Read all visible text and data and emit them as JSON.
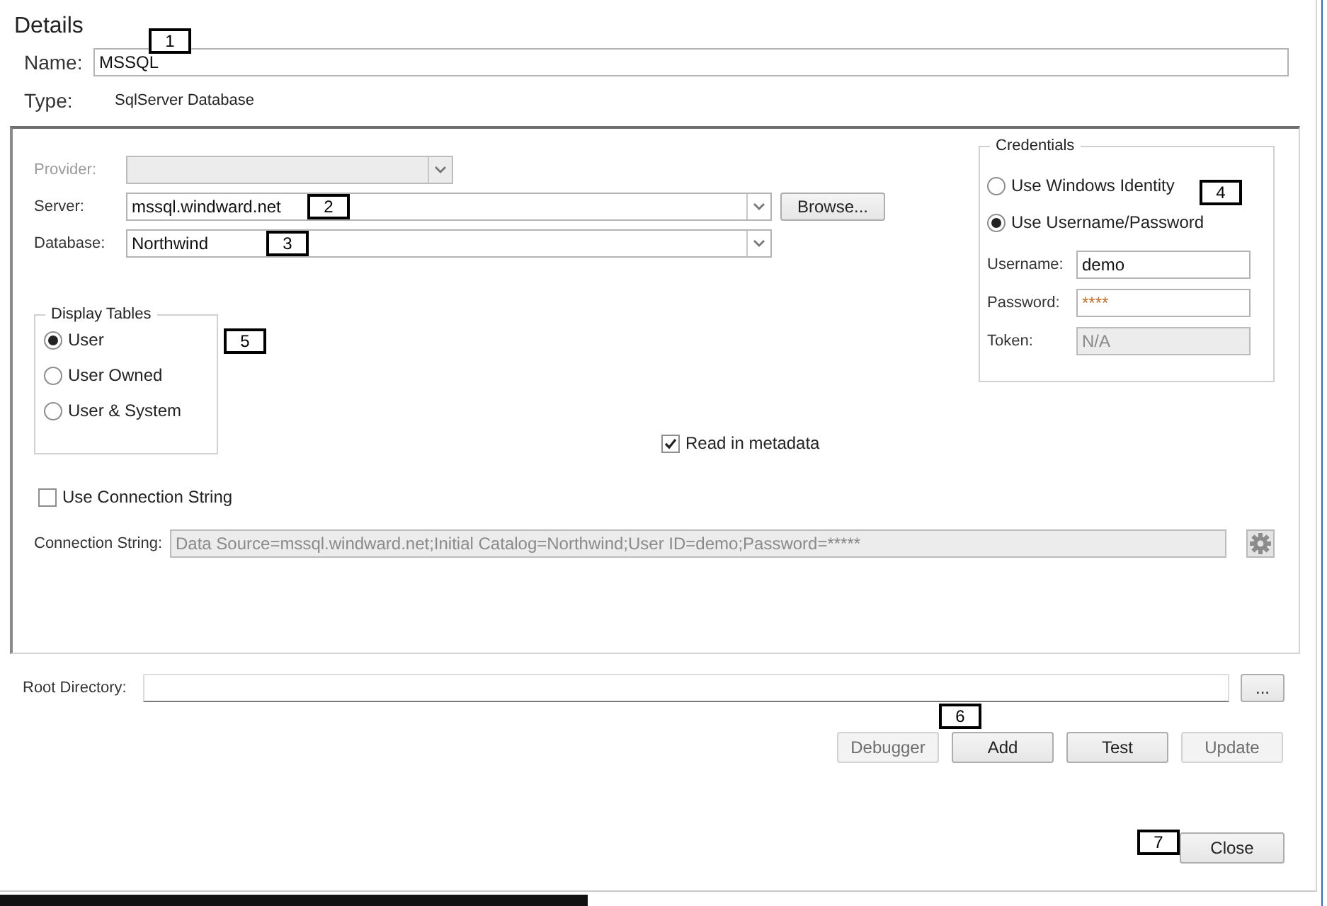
{
  "title": "Details",
  "name_field": {
    "label": "Name:",
    "value": "MSSQL"
  },
  "type": {
    "label": "Type:",
    "value": "SqlServer Database"
  },
  "provider": {
    "label": "Provider:",
    "disabled": true
  },
  "server": {
    "label": "Server:",
    "value": "mssql.windward.net",
    "disabled": false
  },
  "browse_button": {
    "label": "Browse...",
    "disabled": false
  },
  "database": {
    "label": "Database:",
    "value": "Northwind",
    "disabled": false
  },
  "display_tables": {
    "title": "Display Tables",
    "options": [
      {
        "label": "User",
        "selected": true
      },
      {
        "label": "User Owned",
        "selected": false
      },
      {
        "label": "User & System",
        "selected": false
      }
    ]
  },
  "read_metadata": {
    "label": "Read in metadata",
    "checked": true
  },
  "use_connection_string": {
    "label": "Use Connection String",
    "checked": false
  },
  "connection_string": {
    "label": "Connection String:",
    "value": "Data Source=mssql.windward.net;Initial Catalog=Northwind;User ID=demo;Password=*****",
    "disabled": true
  },
  "credentials": {
    "title": "Credentials",
    "options": [
      {
        "label": "Use Windows Identity",
        "selected": false
      },
      {
        "label": "Use Username/Password",
        "selected": true
      }
    ],
    "fields": [
      {
        "kind": "text",
        "label": "Username:",
        "value": "demo",
        "disabled": false
      },
      {
        "kind": "password",
        "label": "Password:",
        "value": "****",
        "disabled": false
      },
      {
        "kind": "text",
        "label": "Token:",
        "value": "N/A",
        "disabled": true
      }
    ]
  },
  "root_directory": {
    "label": "Root Directory:"
  },
  "root_browse_button": {
    "label": "...",
    "disabled": false
  },
  "actions": [
    {
      "label": "Debugger",
      "disabled": true
    },
    {
      "label": "Add",
      "disabled": false
    },
    {
      "label": "Test",
      "disabled": false
    },
    {
      "label": "Update",
      "disabled": true
    }
  ],
  "close_button": {
    "label": "Close",
    "disabled": false
  },
  "callouts": [
    {
      "number": "1"
    },
    {
      "number": "2"
    },
    {
      "number": "3"
    },
    {
      "number": "4"
    },
    {
      "number": "5"
    },
    {
      "number": "6"
    },
    {
      "number": "7"
    }
  ]
}
